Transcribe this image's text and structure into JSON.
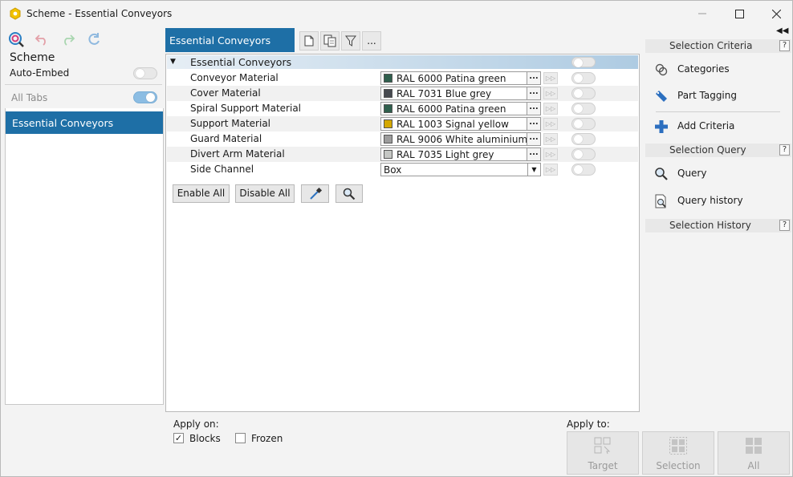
{
  "window": {
    "title": "Scheme - Essential Conveyors",
    "controls": [
      "minimize",
      "maximize",
      "close"
    ]
  },
  "left_panel": {
    "toolbar_icons": [
      "scheme-search-icon",
      "undo-icon",
      "redo-icon",
      "refresh-icon"
    ],
    "heading": "Scheme",
    "auto_embed_label": "Auto-Embed",
    "auto_embed_on": false,
    "all_tabs_label": "All Tabs",
    "all_tabs_on": true,
    "tabs": [
      {
        "label": "Essential Conveyors",
        "selected": true
      }
    ]
  },
  "center": {
    "active_tab": "Essential Conveyors",
    "toolbar_icons": [
      "new-document-icon",
      "copy-icon",
      "filter-icon",
      "more-icon"
    ],
    "more_label": "...",
    "group": {
      "label": "Essential Conveyors",
      "expanded": true,
      "enabled": false
    },
    "rows": [
      {
        "label": "Conveyor Material",
        "value": "RAL 6000 Patina green",
        "color": "#2f5f4d",
        "kind": "color",
        "enabled": false
      },
      {
        "label": "Cover Material",
        "value": "RAL 7031 Blue grey",
        "color": "#474a50",
        "kind": "color",
        "enabled": false
      },
      {
        "label": "Spiral Support Material",
        "value": "RAL 6000 Patina green",
        "color": "#2f5f4d",
        "kind": "color",
        "enabled": false
      },
      {
        "label": "Support Material",
        "value": "RAL 1003 Signal yellow",
        "color": "#d4a800",
        "kind": "color",
        "enabled": false
      },
      {
        "label": "Guard Material",
        "value": "RAL 9006 White aluminium",
        "color": "#9c9c9c",
        "kind": "color",
        "enabled": false
      },
      {
        "label": "Divert Arm Material",
        "value": "RAL 7035 Light grey",
        "color": "#c5c7c4",
        "kind": "color",
        "enabled": false
      },
      {
        "label": "Side Channel",
        "value": "Box",
        "kind": "select",
        "enabled": false
      }
    ],
    "dots_label": "...",
    "buttons": {
      "enable_all": "Enable All",
      "disable_all": "Disable All",
      "pick_icon": "eyedropper-icon",
      "search_icon": "magnifier-icon"
    }
  },
  "bottom": {
    "apply_on_label": "Apply on:",
    "blocks_label": "Blocks",
    "blocks_checked": true,
    "frozen_label": "Frozen",
    "frozen_checked": false,
    "apply_to_label": "Apply to:",
    "apply_buttons": [
      {
        "label": "Target",
        "icon": "target-grid-icon"
      },
      {
        "label": "Selection",
        "icon": "selection-grid-icon"
      },
      {
        "label": "All",
        "icon": "all-grid-icon"
      }
    ]
  },
  "right_panel": {
    "selection_criteria": "Selection Criteria",
    "categories": "Categories",
    "part_tagging": "Part Tagging",
    "add_criteria": "Add Criteria",
    "selection_query": "Selection Query",
    "query": "Query",
    "query_history": "Query history",
    "selection_history": "Selection History",
    "help": "?"
  },
  "colors": {
    "accent": "#1e6fa6",
    "toggle_on": "#8cbde3"
  }
}
